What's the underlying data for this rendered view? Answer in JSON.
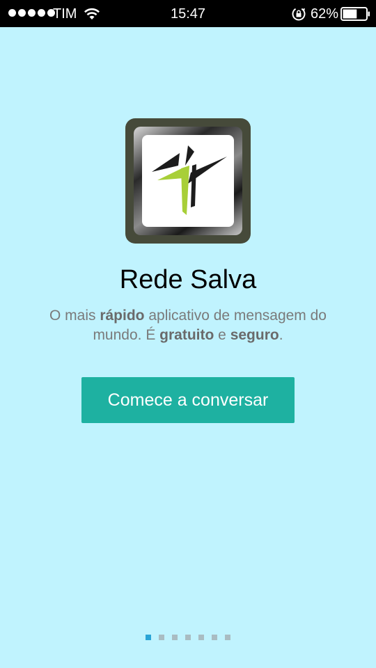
{
  "status_bar": {
    "carrier": "TIM",
    "time": "15:47",
    "battery_percent": "62%",
    "battery_level": 0.62,
    "signal_bars": 5,
    "icons": [
      "signal-dots-icon",
      "wifi-icon",
      "rotation-lock-icon",
      "battery-icon"
    ]
  },
  "welcome": {
    "app_icon": "rede-salva-cross-logo-icon",
    "title": "Rede Salva",
    "tagline": {
      "part1": "O mais ",
      "bold1": "rápido",
      "part2": " aplicativo de mensagem do mundo. É ",
      "bold2": "gratuito",
      "part3": " e ",
      "bold3": "seguro",
      "part4": "."
    },
    "start_button_label": "Comece a conversar"
  },
  "pager": {
    "total_pages": 7,
    "current_page": 1
  },
  "colors": {
    "background": "#c0f3fe",
    "button": "#1eb1a1",
    "dot_active": "#2ba4d6",
    "dot_inactive": "#a9bcc2",
    "logo_green": "#a8cf38"
  }
}
